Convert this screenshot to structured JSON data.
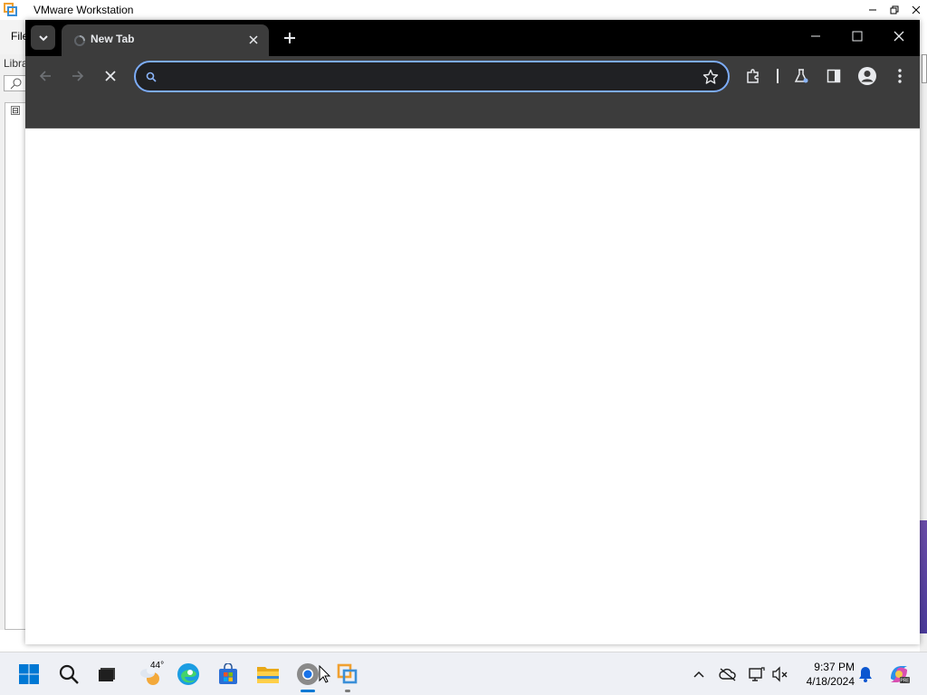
{
  "vmware": {
    "title": "VMware Workstation",
    "menu_file": "File",
    "library_label": "Libra",
    "tree_toggle": "⊟"
  },
  "chrome": {
    "tab": {
      "title": "New Tab"
    },
    "omnibox": {
      "value": "",
      "placeholder": ""
    }
  },
  "taskbar": {
    "weather_temp": "44°",
    "clock": {
      "time": "9:37 PM",
      "date": "4/18/2024"
    }
  },
  "colors": {
    "chrome_dark": "#3c3c3c",
    "tabstrip": "#000000",
    "omnibox_focus": "#7cacf8",
    "taskbar": "#eef0f5",
    "windows_blue": "#0078d4"
  }
}
